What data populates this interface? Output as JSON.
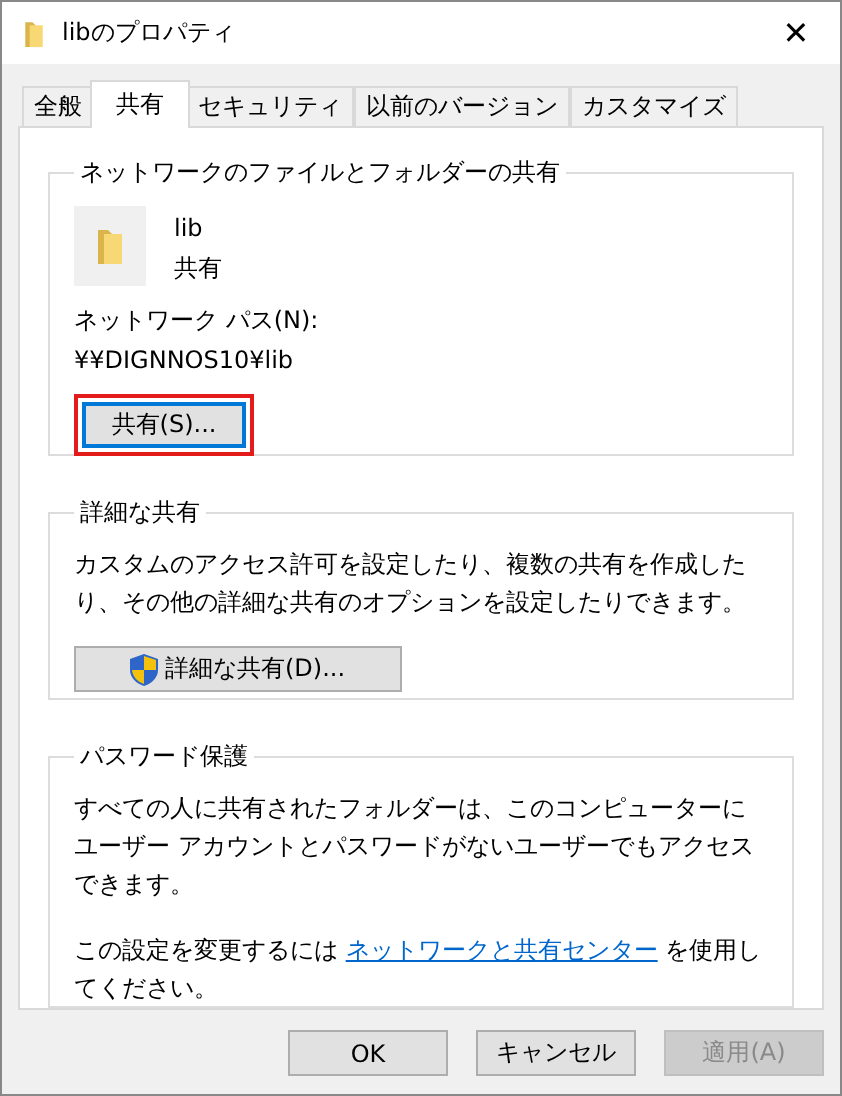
{
  "window": {
    "title": "libのプロパティ",
    "close": "✕"
  },
  "tabs": [
    {
      "label": "全般",
      "selected": false
    },
    {
      "label": "共有",
      "selected": true
    },
    {
      "label": "セキュリティ",
      "selected": false
    },
    {
      "label": "以前のバージョン",
      "selected": false
    },
    {
      "label": "カスタマイズ",
      "selected": false
    }
  ],
  "network_sharing": {
    "title": "ネットワークのファイルとフォルダーの共有",
    "folder_name": "lib",
    "folder_state": "共有",
    "path_label": "ネットワーク パス(N):",
    "path": "¥¥DIGNNOS10¥lib",
    "share_button": {
      "label": "共有(S)...",
      "focused": true,
      "highlighted": true
    }
  },
  "advanced_sharing": {
    "title": "詳細な共有",
    "description": "カスタムのアクセス許可を設定したり、複数の共有を作成したり、その他の詳細な共有のオプションを設定したりできます。",
    "button": "詳細な共有(D)..."
  },
  "password_protection": {
    "title": "パスワード保護",
    "description": "すべての人に共有されたフォルダーは、このコンピューターにユーザー アカウントとパスワードがないユーザーでもアクセスできます。",
    "note_before": "この設定を変更するには",
    "link": "ネットワークと共有センター",
    "note_after": "を使用してください。"
  },
  "buttons": [
    {
      "label": "OK",
      "disabled": false
    },
    {
      "label": "キャンセル",
      "disabled": false
    },
    {
      "label": "適用(A)",
      "disabled": true
    }
  ]
}
